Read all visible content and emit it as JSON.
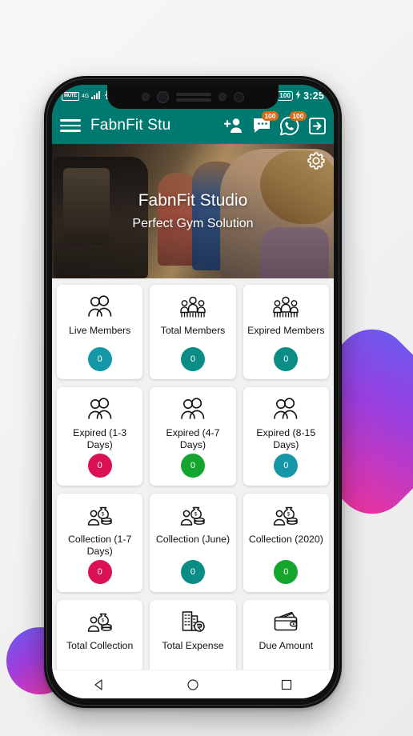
{
  "statusbar": {
    "mute_label": "MUTE",
    "network_label": "4G",
    "battery_label": "100",
    "time": "3:25"
  },
  "appbar": {
    "menu_icon": "hamburger-menu-icon",
    "title": "FabnFit Stu",
    "actions": [
      {
        "name": "add-member-icon",
        "badge": null
      },
      {
        "name": "sms-chat-icon",
        "badge": "100"
      },
      {
        "name": "whatsapp-icon",
        "badge": "100"
      },
      {
        "name": "logout-icon",
        "badge": null
      }
    ]
  },
  "hero": {
    "title": "FabnFit Studio",
    "subtitle": "Perfect Gym Solution",
    "settings_icon": "gear-icon"
  },
  "dashboard": {
    "cards": [
      {
        "label": "Live Members",
        "count": "0",
        "color": "#1597A8",
        "icon": "two-people-icon"
      },
      {
        "label": "Total Members",
        "count": "0",
        "color": "#0B8C85",
        "icon": "group-people-icon"
      },
      {
        "label": "Expired Members",
        "count": "0",
        "color": "#0B8C85",
        "icon": "group-people-icon"
      },
      {
        "label": "Expired (1-3 Days)",
        "count": "0",
        "color": "#DB1155",
        "icon": "two-people-icon"
      },
      {
        "label": "Expired (4-7 Days)",
        "count": "0",
        "color": "#13A52E",
        "icon": "two-people-icon"
      },
      {
        "label": "Expired (8-15 Days)",
        "count": "0",
        "color": "#1597A8",
        "icon": "two-people-icon"
      },
      {
        "label": "Collection (1-7 Days)",
        "count": "0",
        "color": "#DB1155",
        "icon": "money-bag-person-icon"
      },
      {
        "label": "Collection (June)",
        "count": "0",
        "color": "#0B8C85",
        "icon": "money-bag-person-icon"
      },
      {
        "label": "Collection (2020)",
        "count": "0",
        "color": "#13A52E",
        "icon": "money-bag-person-icon"
      },
      {
        "label": "Total Collection",
        "count": null,
        "color": null,
        "icon": "money-bag-person-icon"
      },
      {
        "label": "Total Expense",
        "count": null,
        "color": null,
        "icon": "building-rupee-icon"
      },
      {
        "label": "Due Amount",
        "count": null,
        "color": null,
        "icon": "wallet-icon"
      }
    ]
  },
  "navbar": {
    "back_icon": "back-triangle-icon",
    "home_icon": "home-circle-icon",
    "recents_icon": "recents-square-icon"
  },
  "theme": {
    "primary": "#007A70",
    "badge_orange": "#D86A13",
    "teal_light": "#1597A8",
    "teal_dark": "#0B8C85",
    "pink": "#DB1155",
    "green": "#13A52E"
  }
}
